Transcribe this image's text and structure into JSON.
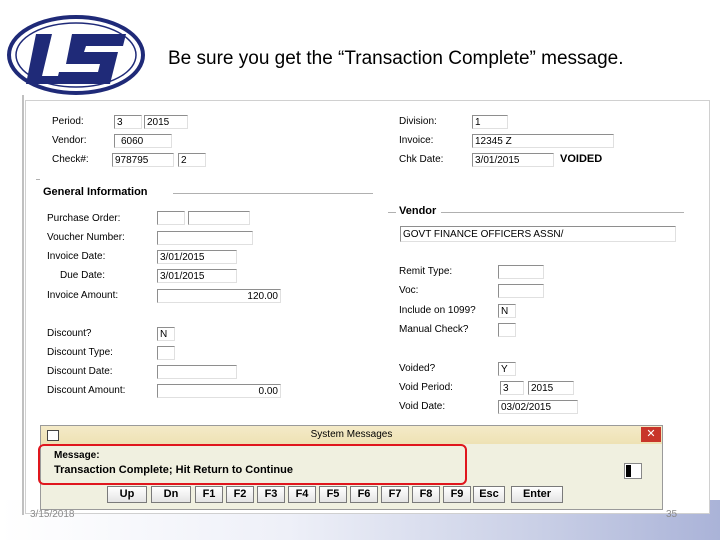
{
  "slide": {
    "title": "Be sure you get the “Transaction Complete” message.",
    "date": "3/15/2018",
    "page_number": "35",
    "logo_text": "IS"
  },
  "form": {
    "top": {
      "period_label": "Period:",
      "period_value": "3",
      "period_year": "2015",
      "vendor_label": "Vendor:",
      "vendor_value": "6060",
      "check_label": "Check#:",
      "check_value": "978795",
      "check_suffix": "2",
      "division_label": "Division:",
      "division_value": "1",
      "invoice_label": "Invoice:",
      "invoice_value": "12345 Z",
      "chk_date_label": "Chk Date:",
      "chk_date_value": "3/01/2015",
      "voided_status": "VOIDED"
    },
    "general": {
      "header": "General Information",
      "po_label": "Purchase Order:",
      "voucher_label": "Voucher Number:",
      "invoice_date_label": "Invoice Date:",
      "invoice_date_value": "3/01/2015",
      "due_date_label": "Due Date:",
      "due_date_value": "3/01/2015",
      "invoice_amount_label": "Invoice Amount:",
      "invoice_amount_value": "120.00",
      "discount_label": "Discount?",
      "discount_value": "N",
      "discount_type_label": "Discount Type:",
      "discount_date_label": "Discount Date:",
      "discount_amount_label": "Discount Amount:",
      "discount_amount_value": "0.00"
    },
    "vendor": {
      "header": "Vendor",
      "name": "GOVT FINANCE OFFICERS ASSN/",
      "remit_type_label": "Remit Type:",
      "voc_label": "Voc:",
      "include_1099_label": "Include on 1099?",
      "include_1099_value": "N",
      "manual_check_label": "Manual Check?",
      "voided_label": "Voided?",
      "voided_value": "Y",
      "void_period_label": "Void Period:",
      "void_period_value": "3",
      "void_period_year": "2015",
      "void_date_label": "Void Date:",
      "void_date_value": "03/02/2015"
    }
  },
  "dialog": {
    "title": "System Messages",
    "message_label": "Message:",
    "message_text": "Transaction Complete; Hit Return to Continue",
    "buttons": [
      "Up",
      "Dn",
      "F1",
      "F2",
      "F3",
      "F4",
      "F5",
      "F6",
      "F7",
      "F8",
      "F9",
      "Esc",
      "Enter"
    ]
  }
}
